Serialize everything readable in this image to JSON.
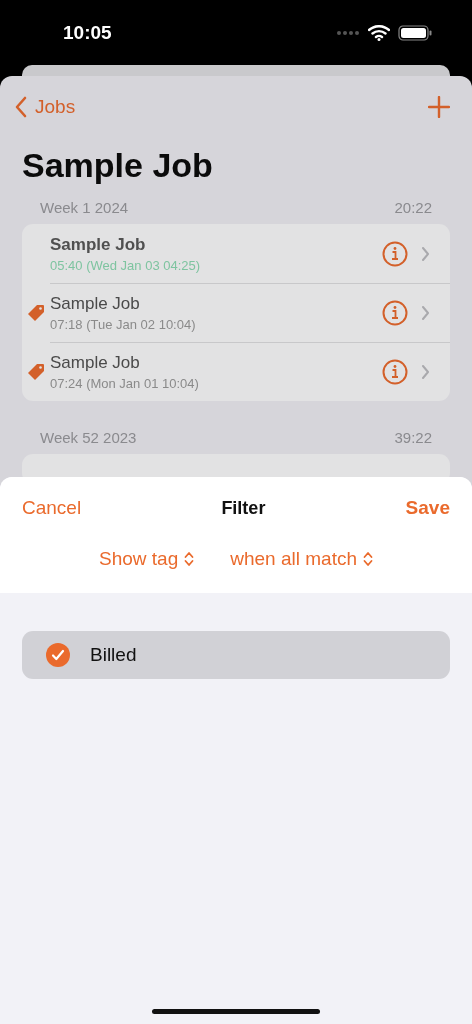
{
  "status_bar": {
    "time": "10:05"
  },
  "nav": {
    "back": "Jobs",
    "title": "Sample Job"
  },
  "sections": [
    {
      "title": "Week 1 2024",
      "total": "20:22",
      "rows": [
        {
          "title": "Sample Job",
          "subtitle": "05:40 (Wed Jan 03 04:25)",
          "active": true,
          "tagged": false
        },
        {
          "title": "Sample Job",
          "subtitle": "07:18 (Tue Jan 02 10:04)",
          "active": false,
          "tagged": true
        },
        {
          "title": "Sample Job",
          "subtitle": "07:24 (Mon Jan 01 10:04)",
          "active": false,
          "tagged": true
        }
      ]
    },
    {
      "title": "Week 52 2023",
      "total": "39:22"
    }
  ],
  "sheet": {
    "cancel": "Cancel",
    "title": "Filter",
    "save": "Save",
    "pickers": [
      {
        "label": "Show tag"
      },
      {
        "label": "when all match"
      }
    ],
    "tags": [
      {
        "label": "Billed",
        "checked": true
      }
    ]
  }
}
